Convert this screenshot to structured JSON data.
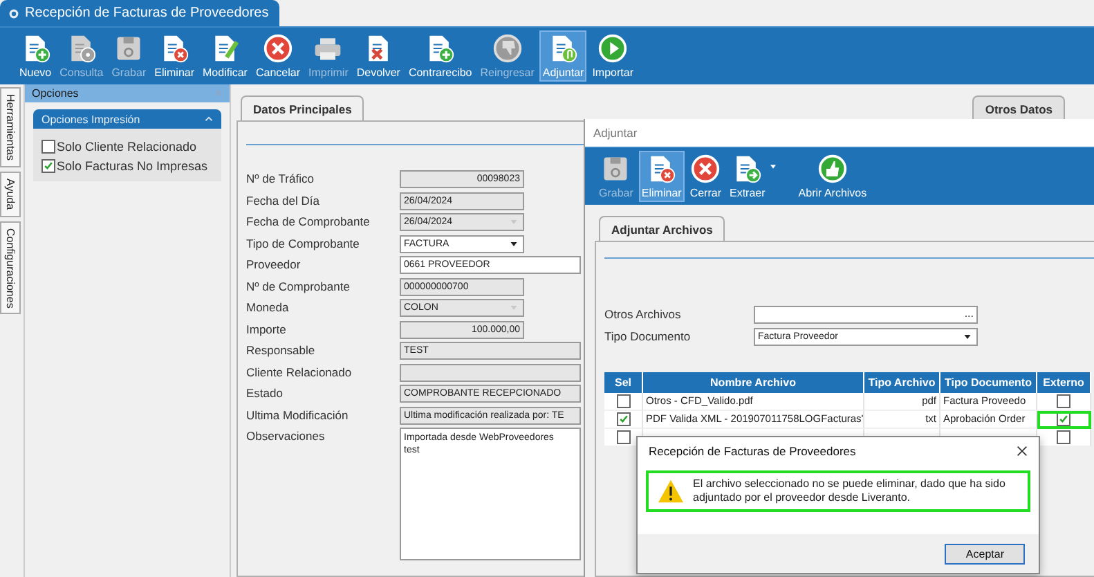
{
  "app": {
    "title": "Recepción de Facturas de Proveedores"
  },
  "toolbar": [
    {
      "label": "Nuevo",
      "disabled": false,
      "selected": false
    },
    {
      "label": "Consulta",
      "disabled": true,
      "selected": false
    },
    {
      "label": "Grabar",
      "disabled": true,
      "selected": false
    },
    {
      "label": "Eliminar",
      "disabled": false,
      "selected": false
    },
    {
      "label": "Modificar",
      "disabled": false,
      "selected": false
    },
    {
      "label": "Cancelar",
      "disabled": false,
      "selected": false
    },
    {
      "label": "Imprimir",
      "disabled": true,
      "selected": false
    },
    {
      "label": "Devolver",
      "disabled": false,
      "selected": false
    },
    {
      "label": "Contrarecibo",
      "disabled": false,
      "selected": false
    },
    {
      "label": "Reingresar",
      "disabled": true,
      "selected": false
    },
    {
      "label": "Adjuntar",
      "disabled": false,
      "selected": true
    },
    {
      "label": "Importar",
      "disabled": false,
      "selected": false
    }
  ],
  "vertical_tabs": [
    "Herramientas",
    "Ayuda",
    "Configuraciones"
  ],
  "options_panel": {
    "title": "Opciones",
    "group": {
      "title": "Opciones Impresión",
      "expanded": true,
      "checkboxes": [
        {
          "label": "Solo Cliente Relacionado",
          "checked": false
        },
        {
          "label": "Solo Facturas No Impresas",
          "checked": true
        }
      ]
    }
  },
  "tabs": [
    {
      "label": "Datos Principales",
      "selected": true
    },
    {
      "label": "Otros Datos",
      "selected": false
    }
  ],
  "form": [
    {
      "label": "Nº de Tráfico",
      "value": "00098023",
      "kind": "number"
    },
    {
      "label": "Fecha del Día",
      "value": "26/04/2024",
      "kind": "readonly"
    },
    {
      "label": "Fecha de Comprobante",
      "value": "26/04/2024",
      "kind": "combo-disabled"
    },
    {
      "label": "Tipo de Comprobante",
      "value": "FACTURA",
      "kind": "combo"
    },
    {
      "label": "Proveedor",
      "value": "0661 PROVEEDOR",
      "kind": "lookup"
    },
    {
      "label": "Nº de Comprobante",
      "value": "000000000700",
      "kind": "readonly"
    },
    {
      "label": "Moneda",
      "value": "COLON",
      "kind": "combo-disabled"
    },
    {
      "label": "Importe",
      "value": "100.000,00",
      "kind": "number"
    },
    {
      "label": "Responsable",
      "value": "TEST",
      "kind": "readonly-wide"
    },
    {
      "label": "Cliente Relacionado",
      "kind": "readonly-wide"
    },
    {
      "label": "Estado",
      "value": "COMPROBANTE RECEPCIONADO",
      "kind": "readonly-wide"
    },
    {
      "label": "Ultima Modificación",
      "value": "Ultima modificación realizada por: TE",
      "kind": "readonly-wide"
    },
    {
      "label": "Observaciones",
      "value": "Importada desde WebProveedores\ntest",
      "kind": "memo"
    }
  ],
  "attach_window": {
    "title": "Adjuntar",
    "toolbar": [
      {
        "label": "Grabar",
        "disabled": true,
        "selected": false,
        "dropdown": false
      },
      {
        "label": "Eliminar",
        "disabled": false,
        "selected": true,
        "dropdown": false
      },
      {
        "label": "Cerrar",
        "disabled": false,
        "selected": false,
        "dropdown": false
      },
      {
        "label": "Extraer",
        "disabled": false,
        "selected": false,
        "dropdown": true
      },
      {
        "label": "Abrir Archivos",
        "disabled": false,
        "selected": false,
        "dropdown": false
      }
    ],
    "tabs": [
      {
        "label": "Adjuntar Archivos",
        "selected": true
      }
    ],
    "fields": [
      {
        "label": "Otros Archivos",
        "kind": "browse",
        "button": "..."
      },
      {
        "label": "Tipo Documento",
        "value": "Factura Proveedor",
        "kind": "combo"
      }
    ],
    "table": {
      "columns": [
        "Sel",
        "Nombre Archivo",
        "Tipo Archivo",
        "Tipo Documento",
        "Externo"
      ],
      "rows": [
        {
          "sel": false,
          "name": "Otros - CFD_Valido.pdf",
          "file_type": "pdf",
          "doc_type": "Factura Proveedo",
          "externo": false,
          "highlighted": false
        },
        {
          "sel": true,
          "name": "PDF Valida XML - 201907011758LOGFacturas'",
          "file_type": "txt",
          "doc_type": "Aprobación Order",
          "externo": true,
          "highlighted": true
        },
        {
          "sel": false,
          "externo": false,
          "highlighted": false
        }
      ]
    }
  },
  "dialog": {
    "title": "Recepción de Facturas de Proveedores",
    "message": "El archivo seleccionado no se puede eliminar, dado que ha sido adjuntado por el proveedor desde Liveranto.",
    "message_highlighted": true,
    "button": "Aceptar"
  }
}
